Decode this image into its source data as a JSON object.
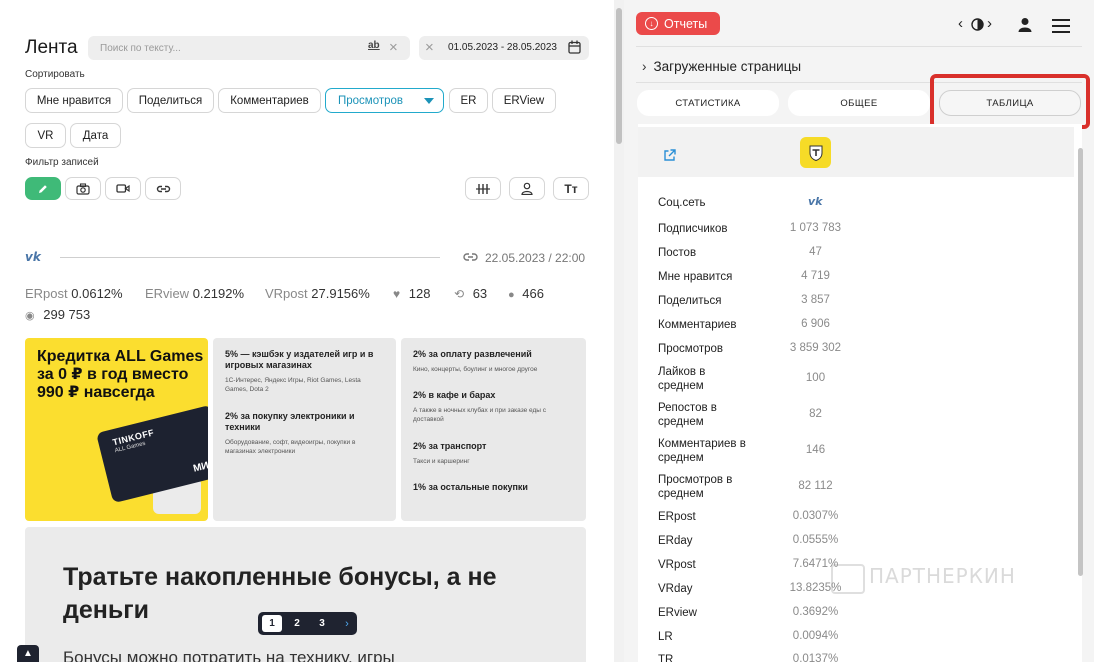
{
  "feed": {
    "title": "Лента",
    "search": {
      "placeholder": "Поиск по тексту..."
    },
    "date_range": "01.05.2023 - 28.05.2023",
    "sort_label": "Сортировать",
    "sort_chips": [
      "Мне нравится",
      "Поделиться",
      "Комментариев",
      "Просмотров",
      "ER",
      "ERView",
      "VR",
      "Дата"
    ],
    "filter_label": "Фильтр записей"
  },
  "post": {
    "network": "vk",
    "date": "22.05.2023 / 22:00",
    "stats": {
      "erpost_label": "ERpost",
      "erpost": "0.0612%",
      "erview_label": "ERview",
      "erview": "0.2192%",
      "vrpost_label": "VRpost",
      "vrpost": "27.9156%",
      "likes": "128",
      "reposts": "63",
      "comments": "466",
      "views": "299 753"
    },
    "banner1": {
      "title": "Кредитка ALL Games за 0 ₽ в год вместо 990 ₽ навсегда",
      "card_brand": "TINKOFF",
      "card_sub": "ALL Games",
      "card_mir": "МИР"
    },
    "banner2": [
      {
        "title": "5% — кэшбэк у издателей игр и в игровых магазинах",
        "sub": "1С-Интерес, Яндекс Игры, Riot Games, Lesta Games, Dota 2"
      },
      {
        "title": "2% за покупку электроники и техники",
        "sub": "Оборудование, софт, видеоигры, покупки в магазинах электроники"
      }
    ],
    "banner3": [
      {
        "title": "2% за оплату развлечений",
        "sub": "Кино, концерты, боулинг и многое другое"
      },
      {
        "title": "2% в кафе и барах",
        "sub": "А также в ночных клубах и при заказе еды с доставкой"
      },
      {
        "title": "2% за транспорт",
        "sub": "Такси и каршеринг"
      },
      {
        "title": "1% за остальные покупки",
        "sub": ""
      }
    ],
    "banner4": {
      "title": "Тратьте накопленные бонусы, а не деньги",
      "sub": "Бонусы можно потратить на технику, игры"
    }
  },
  "pagination": {
    "pages": [
      "1",
      "2",
      "3"
    ],
    "current": "1"
  },
  "panel": {
    "reports_label": "Отчеты",
    "loaded_pages": "Загруженные страницы",
    "tabs": [
      "СТАТИСТИКА",
      "ОБЩЕЕ",
      "ТАБЛИЦА"
    ],
    "selected_tab": "ТАБЛИЦА",
    "accent_color": "#eb4a4a",
    "highlight_color": "#d9302b",
    "rows": [
      {
        "label": "Соц.сеть",
        "value": "vk"
      },
      {
        "label": "Подписчиков",
        "value": "1 073 783"
      },
      {
        "label": "Постов",
        "value": "47"
      },
      {
        "label": "Мне нравится",
        "value": "4 719"
      },
      {
        "label": "Поделиться",
        "value": "3 857"
      },
      {
        "label": "Комментариев",
        "value": "6 906"
      },
      {
        "label": "Просмотров",
        "value": "3 859 302"
      },
      {
        "label": "Лайков в среднем",
        "value": "100"
      },
      {
        "label": "Репостов в среднем",
        "value": "82"
      },
      {
        "label": "Комментариев в среднем",
        "value": "146"
      },
      {
        "label": "Просмотров в среднем",
        "value": "82 112"
      },
      {
        "label": "ERpost",
        "value": "0.0307%"
      },
      {
        "label": "ERday",
        "value": "0.0555%"
      },
      {
        "label": "VRpost",
        "value": "7.6471%"
      },
      {
        "label": "VRday",
        "value": "13.8235%"
      },
      {
        "label": "ERview",
        "value": "0.3692%"
      },
      {
        "label": "LR",
        "value": "0.0094%"
      },
      {
        "label": "TR",
        "value": "0.0137%"
      }
    ],
    "watermark": "ПАРТНЕРКИН"
  }
}
